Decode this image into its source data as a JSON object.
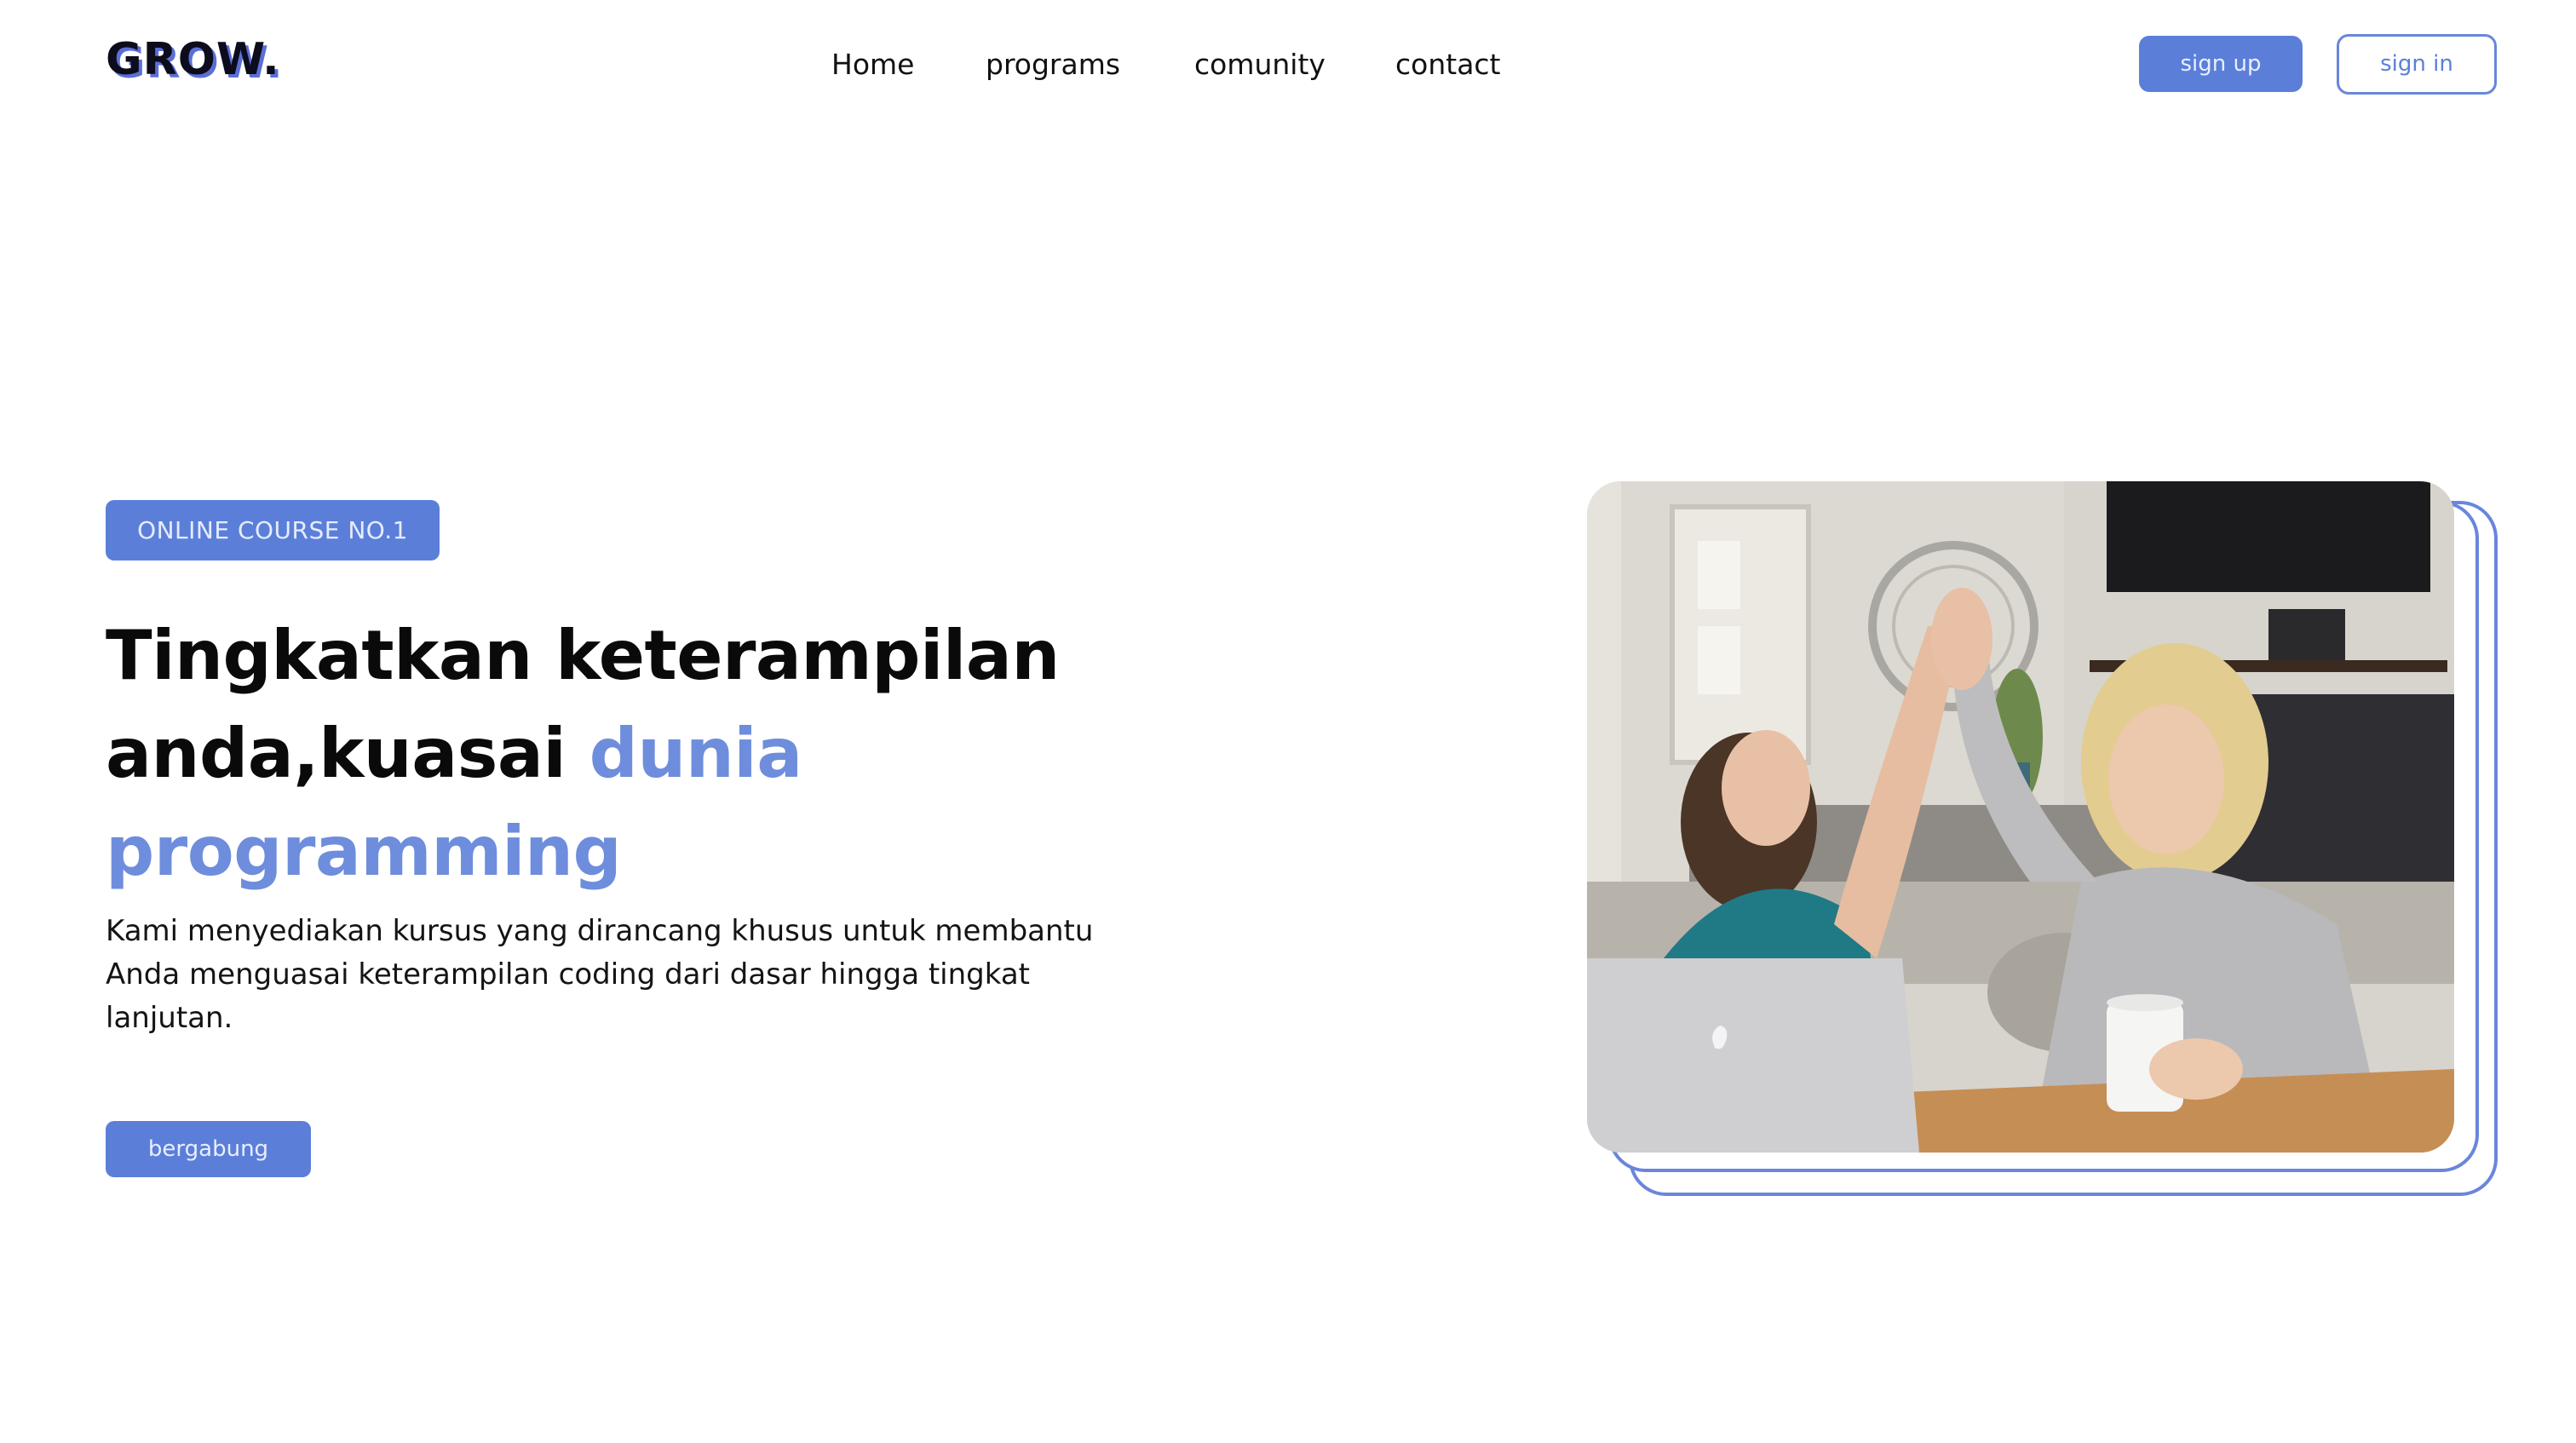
{
  "brand": {
    "logo": "GROW."
  },
  "nav": {
    "home": "Home",
    "programs": "programs",
    "comunity": "comunity",
    "contact": "contact"
  },
  "auth": {
    "signup": "sign up",
    "signin": "sign in"
  },
  "hero": {
    "badge": "ONLINE COURSE NO.1",
    "headline_line1": "Tingkatkan keterampilan",
    "headline_line2_plain": "anda,kuasai ",
    "headline_line2_accent": "dunia",
    "headline_line3_accent": "programming",
    "description": "Kami menyediakan kursus yang dirancang khusus untuk membantu Anda menguasai keterampilan coding dari dasar hingga tingkat lanjutan.",
    "cta": "bergabung"
  },
  "colors": {
    "accent": "#5b7fd9",
    "accent_text": "#6e8ddc",
    "frame_border": "#6a86db",
    "background": "#ffffff",
    "text": "#0a0a0a"
  },
  "icons": {
    "photo": "high-five-photo"
  }
}
